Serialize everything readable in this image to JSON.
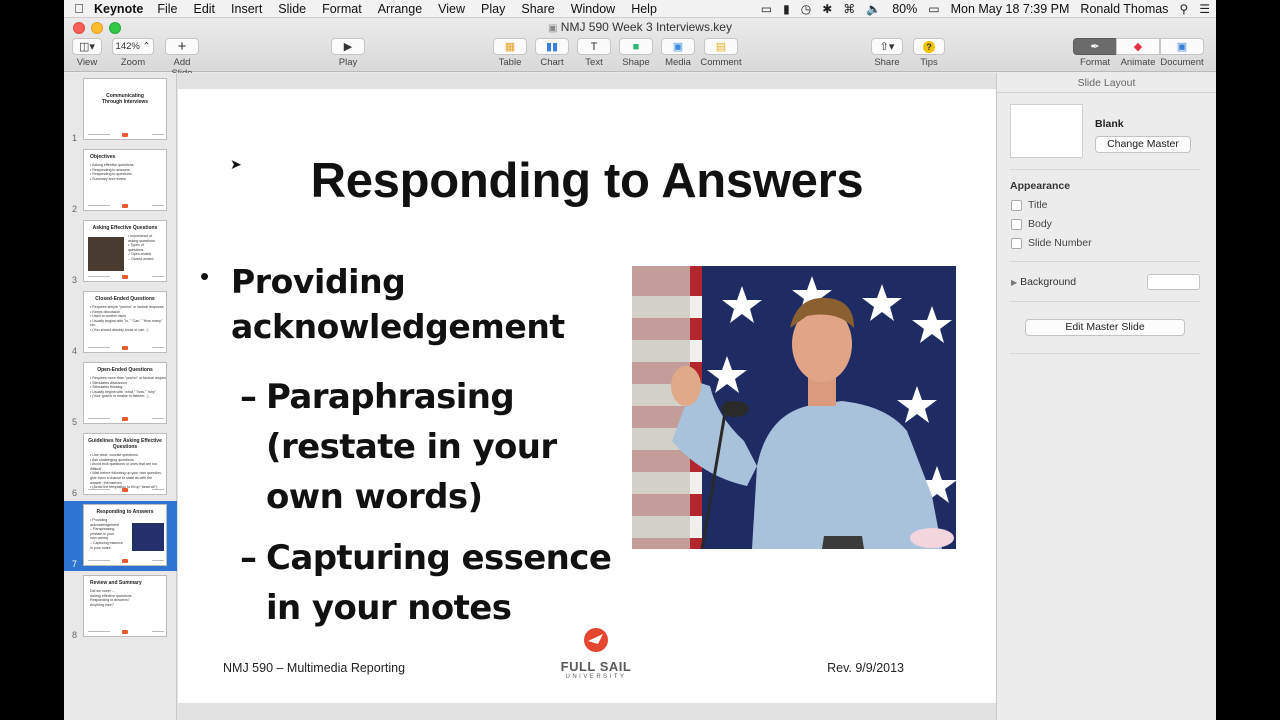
{
  "menubar": {
    "app_name": "Keynote",
    "items": [
      "File",
      "Edit",
      "Insert",
      "Slide",
      "Format",
      "Arrange",
      "View",
      "Play",
      "Share",
      "Window",
      "Help"
    ],
    "battery": "80%",
    "datetime": "Mon May 18  7:39 PM",
    "user": "Ronald Thomas"
  },
  "window": {
    "title": "NMJ 590 Week 3 Interviews.key"
  },
  "toolbar": {
    "view_label": "View",
    "zoom_value": "142%",
    "zoom_label": "Zoom",
    "add_slide_label": "Add Slide",
    "play_label": "Play",
    "table_label": "Table",
    "chart_label": "Chart",
    "text_label": "Text",
    "shape_label": "Shape",
    "media_label": "Media",
    "comment_label": "Comment",
    "share_label": "Share",
    "tips_label": "Tips",
    "format_label": "Format",
    "animate_label": "Animate",
    "document_label": "Document"
  },
  "navigator": {
    "selected": 7,
    "slides": [
      {
        "num": "1",
        "title": "Communicating Through Interviews",
        "lines": []
      },
      {
        "num": "2",
        "title": "Objectives",
        "lines": [
          "• Asking effective questions",
          "• Responding to answers",
          "• Responding to questions",
          "• Summary and review"
        ]
      },
      {
        "num": "3",
        "title": "Asking Effective Questions",
        "lines": [
          "• Importance of",
          "  asking questions",
          "• Types of",
          "  questions",
          "  – Open-ended",
          "  – Closed-ended"
        ]
      },
      {
        "num": "4",
        "title": "Closed-Ended Questions",
        "lines": [
          "• Requires simple \"yes/no\" or factual response",
          "• Keeps discussion",
          "• Used to confirm facts",
          "• Usually begins with \"Is,\" \"Can,\" \"How many,\"",
          "  etc.",
          "• (You should already know or can...)"
        ]
      },
      {
        "num": "5",
        "title": "Open-Ended Questions",
        "lines": [
          "• Requires more than \"yes/no\" or factual response",
          "• Stimulates discussion",
          "• Stimulates thinking",
          "• Usually begins with \"what,\" \"how,\" \"why\"",
          "• (Your goal is to enable to listener...)"
        ]
      },
      {
        "num": "6",
        "title": "Guidelines for Asking Effective Questions",
        "lines": [
          "• Use clear, concise questions",
          "• Ask challenging questions",
          "• Avoid trick questions or ones that are too",
          "  difficult",
          "• Wait before following up your own question,",
          "  give them a chance to state as with the",
          "  answer; themselves",
          "• (Avoid the temptation to fill up \"dead air\")"
        ]
      },
      {
        "num": "7",
        "title": "Responding to Answers",
        "lines": [
          "• Providing",
          "  acknowledgement",
          "  – Paraphrasing",
          "    (restate in your",
          "    own words)",
          "  – Capturing essence",
          "    in your notes"
        ]
      },
      {
        "num": "8",
        "title": "Review and Summary",
        "lines": [
          "Did we cover ...",
          "   Asking effective questions",
          "   Responding to answers?",
          "",
          "Anything else?"
        ]
      }
    ]
  },
  "slide": {
    "title": "Responding to Answers",
    "bullet": "Providing acknowledgement",
    "sub1": "Paraphrasing (restate in your own words)",
    "sub2": "Capturing essence in your notes",
    "dash": "–",
    "dot": "•",
    "footer_left": "NMJ 590 – Multimedia Reporting",
    "footer_right": "Rev. 9/9/2013",
    "logo_line1": "FULL SAIL",
    "logo_line2": "UNIVERSITY"
  },
  "inspector": {
    "header": "Slide Layout",
    "layout_name": "Blank",
    "change_master": "Change Master",
    "appearance": "Appearance",
    "options": [
      "Title",
      "Body",
      "Slide Number"
    ],
    "background": "Background",
    "edit_master": "Edit Master Slide"
  },
  "colors": {
    "selection": "#2f74d0",
    "logo_red": "#e4462f"
  }
}
